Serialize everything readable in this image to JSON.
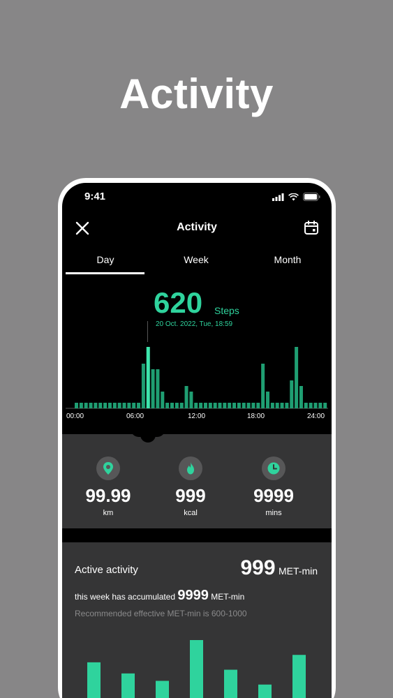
{
  "header": {
    "title": "Activity"
  },
  "status_bar": {
    "time": "9:41"
  },
  "nav": {
    "title": "Activity"
  },
  "tabs": [
    {
      "label": "Day"
    },
    {
      "label": "Week"
    },
    {
      "label": "Month"
    }
  ],
  "selected_tab": "Day",
  "steps": {
    "value": "620",
    "unit": "Steps",
    "timestamp": "20 Oct. 2022, Tue, 18:59"
  },
  "chart_data": {
    "type": "bar",
    "x_ticks": [
      "00:00",
      "06:00",
      "12:00",
      "18:00",
      "24:00"
    ],
    "values": [
      1,
      1,
      1,
      1,
      1,
      1,
      1,
      1,
      1,
      1,
      1,
      1,
      1,
      1,
      8,
      11,
      7,
      7,
      3,
      1,
      1,
      1,
      1,
      4,
      3,
      1,
      1,
      1,
      1,
      1,
      1,
      1,
      1,
      1,
      1,
      1,
      1,
      1,
      1,
      8,
      3,
      1,
      1,
      1,
      1,
      5,
      11,
      4,
      1,
      1,
      1,
      1,
      1
    ],
    "highlight_index": 15,
    "bar_color": "#2fd39d"
  },
  "stats": [
    {
      "icon": "location-pin-icon",
      "value": "99.99",
      "unit": "km"
    },
    {
      "icon": "flame-icon",
      "value": "999",
      "unit": "kcal"
    },
    {
      "icon": "clock-icon",
      "value": "9999",
      "unit": "mins"
    }
  ],
  "active": {
    "title": "Active activity",
    "value": "999",
    "value_unit": "MET-min",
    "week_prefix": "this week has accumulated",
    "week_value": "9999",
    "week_unit": "MET-min",
    "recommendation": "Recommended effective MET-min is 600-1000",
    "bars": [
      5,
      3.5,
      2.5,
      8,
      4,
      2,
      6
    ]
  },
  "colors": {
    "accent": "#2fd39d",
    "background": "#878687",
    "panel": "#353536"
  }
}
